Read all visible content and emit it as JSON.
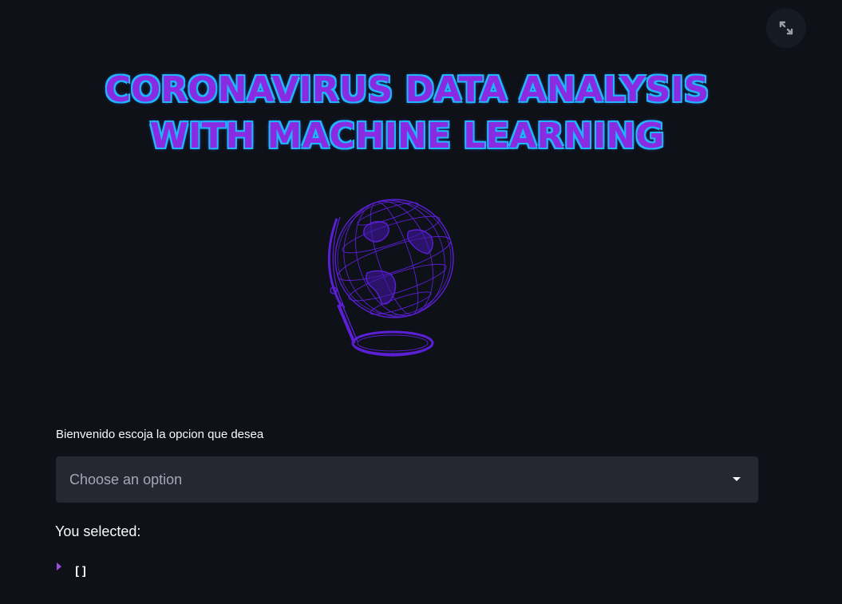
{
  "hero": {
    "title_line_1": "CORONAVIRUS DATA ANALYSIS",
    "title_line_2": "WITH MACHINE LEARNING"
  },
  "icons": {
    "fullscreen": "expand-icon",
    "globe": "globe-icon",
    "dropdown": "chevron-down-icon",
    "json_toggle": "caret-right-icon"
  },
  "form": {
    "select_label": "Bienvenido escoja la opcion que desea",
    "select_placeholder": "Choose an option"
  },
  "result": {
    "label": "You selected:",
    "value": "[]"
  },
  "colors": {
    "background": "#0e1117",
    "title_fill": "#8a2be2",
    "title_outline": "#1fb6ff",
    "globe": "#5b1fd6",
    "select_bg": "#262730",
    "accent": "#9d4edd"
  }
}
